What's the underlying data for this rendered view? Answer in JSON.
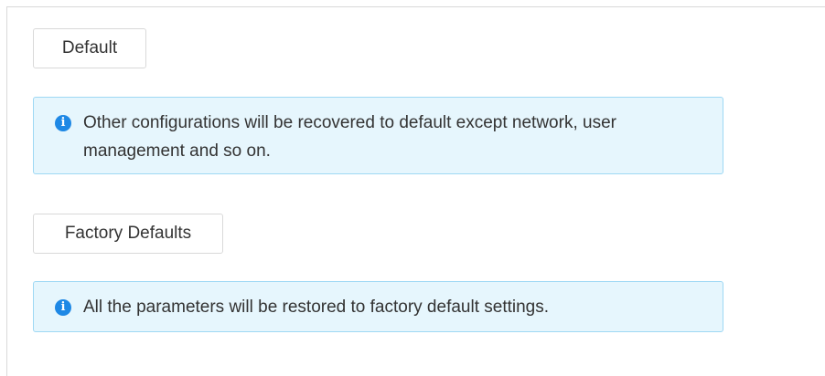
{
  "default_section": {
    "button_label": "Default",
    "notice_text": "Other configurations will be recovered to default except network, user management and so on."
  },
  "factory_section": {
    "button_label": "Factory Defaults",
    "notice_text": "All the parameters will be restored to factory default settings."
  },
  "icons": {
    "info_glyph": "i",
    "info_color": "#1e88e5"
  },
  "colors": {
    "notice_background": "#e6f6fd",
    "notice_border": "#9ed8f4",
    "button_border": "#d9d9d9",
    "text": "#333333"
  }
}
